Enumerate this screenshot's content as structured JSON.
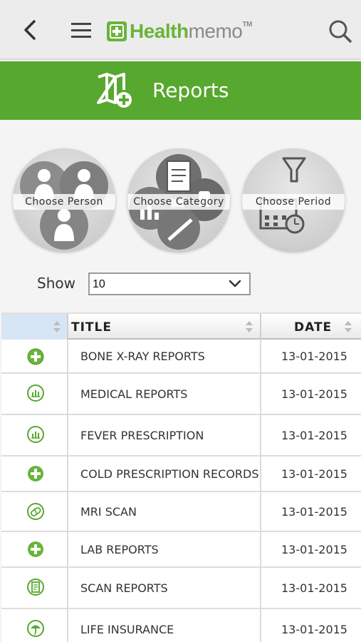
{
  "header": {
    "logo_part1": "Health",
    "logo_part2": "memo",
    "logo_tm": "TM",
    "icons": {
      "back": "back-arrow-icon",
      "menu": "hamburger-menu-icon",
      "search": "search-icon",
      "logo": "medical-cross-icon"
    },
    "brand_green": "#57a82e",
    "logo_green": "#6ab43a"
  },
  "title_bar": {
    "title": "Reports",
    "icon": "map-plus-icon"
  },
  "filters": [
    {
      "label": "Choose Person",
      "icon": "people-icon"
    },
    {
      "label": "Choose Category",
      "icon": "documents-icon"
    },
    {
      "label": "Choose Period",
      "icon": "calendar-filter-icon"
    }
  ],
  "show": {
    "label": "Show",
    "value": "10"
  },
  "table": {
    "headers": {
      "icon": "",
      "title": "TITLE",
      "date": "DATE"
    },
    "rows": [
      {
        "icon": "plus-circle-icon",
        "title": "BONE X-RAY REPORTS",
        "date": "13-01-2015"
      },
      {
        "icon": "chart-circle-icon",
        "title": "MEDICAL REPORTS",
        "date": "13-01-2015"
      },
      {
        "icon": "chart-circle-icon",
        "title": "FEVER PRESCRIPTION",
        "date": "13-01-2015"
      },
      {
        "icon": "plus-circle-icon",
        "title": "COLD PRESCRIPTION RECORDS",
        "date": "13-01-2015"
      },
      {
        "icon": "pill-circle-icon",
        "title": "MRI SCAN",
        "date": "13-01-2015"
      },
      {
        "icon": "plus-circle-icon",
        "title": "LAB REPORTS",
        "date": "13-01-2015"
      },
      {
        "icon": "document-circle-icon",
        "title": "SCAN REPORTS",
        "date": "13-01-2015"
      },
      {
        "icon": "umbrella-circle-icon",
        "title": "LIFE INSURANCE",
        "date": "13-01-2015"
      }
    ]
  }
}
